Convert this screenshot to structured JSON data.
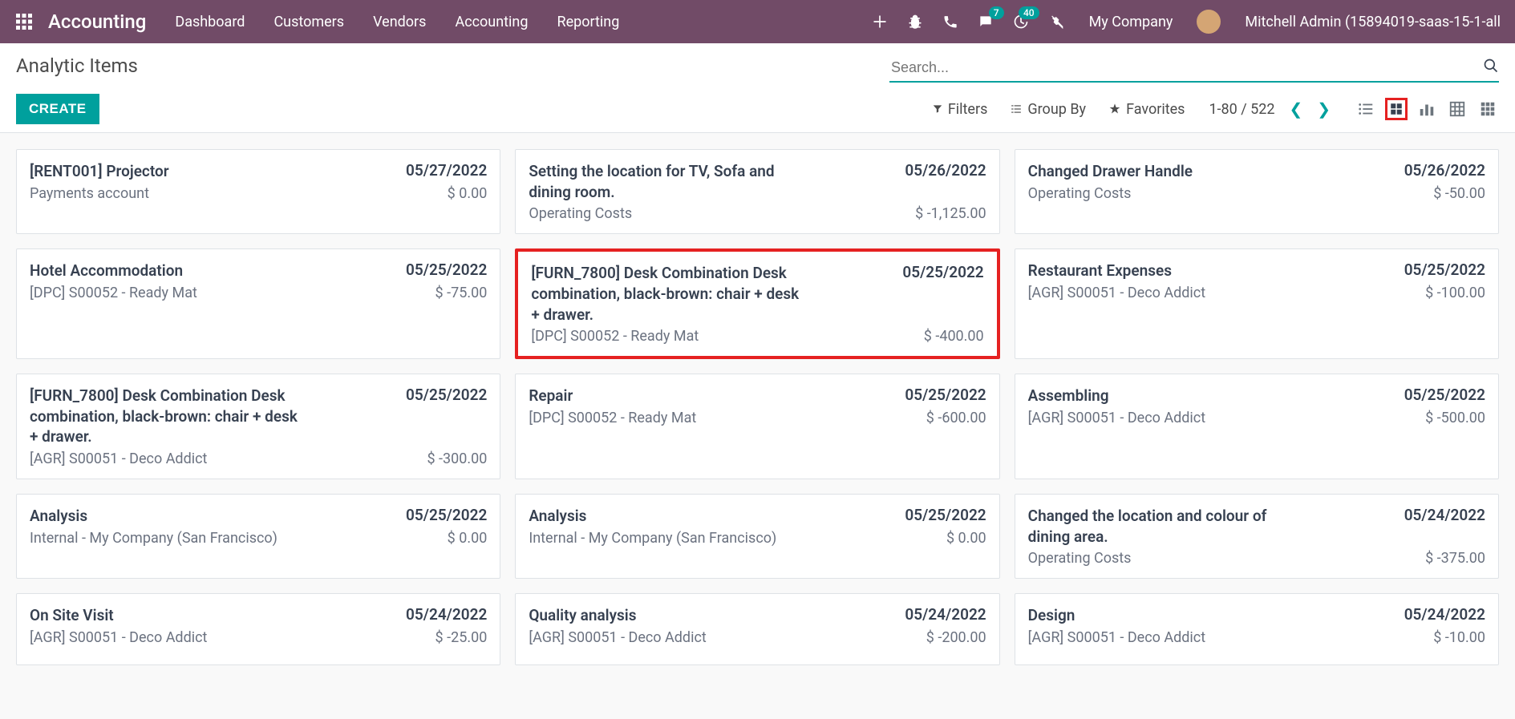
{
  "topnav": {
    "app_title": "Accounting",
    "links": [
      "Dashboard",
      "Customers",
      "Vendors",
      "Accounting",
      "Reporting"
    ],
    "messages_badge": "7",
    "activities_badge": "40",
    "company": "My Company",
    "username": "Mitchell Admin (15894019-saas-15-1-all"
  },
  "page": {
    "title": "Analytic Items",
    "create_label": "CREATE",
    "search_placeholder": "Search...",
    "filters_label": "Filters",
    "groupby_label": "Group By",
    "favorites_label": "Favorites",
    "pager": "1-80 / 522"
  },
  "cards": [
    {
      "title": "[RENT001] Projector",
      "date": "05/27/2022",
      "account": "Payments account",
      "amount": "$ 0.00"
    },
    {
      "title": "Setting the location for TV, Sofa and dining room.",
      "date": "05/26/2022",
      "account": "Operating Costs",
      "amount": "$ -1,125.00"
    },
    {
      "title": "Changed Drawer Handle",
      "date": "05/26/2022",
      "account": "Operating Costs",
      "amount": "$ -50.00"
    },
    {
      "title": "Hotel Accommodation",
      "date": "05/25/2022",
      "account": "[DPC] S00052 - Ready Mat",
      "amount": "$ -75.00"
    },
    {
      "title": "[FURN_7800] Desk Combination Desk combination, black-brown: chair + desk + drawer.",
      "date": "05/25/2022",
      "account": "[DPC] S00052 - Ready Mat",
      "amount": "$ -400.00",
      "highlighted": true
    },
    {
      "title": "Restaurant Expenses",
      "date": "05/25/2022",
      "account": "[AGR] S00051 - Deco Addict",
      "amount": "$ -100.00"
    },
    {
      "title": "[FURN_7800] Desk Combination Desk combination, black-brown: chair + desk + drawer.",
      "date": "05/25/2022",
      "account": "[AGR] S00051 - Deco Addict",
      "amount": "$ -300.00"
    },
    {
      "title": "Repair",
      "date": "05/25/2022",
      "account": "[DPC] S00052 - Ready Mat",
      "amount": "$ -600.00"
    },
    {
      "title": "Assembling",
      "date": "05/25/2022",
      "account": "[AGR] S00051 - Deco Addict",
      "amount": "$ -500.00"
    },
    {
      "title": "Analysis",
      "date": "05/25/2022",
      "account": "Internal - My Company (San Francisco)",
      "amount": "$ 0.00"
    },
    {
      "title": "Analysis",
      "date": "05/25/2022",
      "account": "Internal - My Company (San Francisco)",
      "amount": "$ 0.00"
    },
    {
      "title": "Changed the location and colour of dining area.",
      "date": "05/24/2022",
      "account": "Operating Costs",
      "amount": "$ -375.00"
    },
    {
      "title": "On Site Visit",
      "date": "05/24/2022",
      "account": "[AGR] S00051 - Deco Addict",
      "amount": "$ -25.00"
    },
    {
      "title": "Quality analysis",
      "date": "05/24/2022",
      "account": "[AGR] S00051 - Deco Addict",
      "amount": "$ -200.00"
    },
    {
      "title": "Design",
      "date": "05/24/2022",
      "account": "[AGR] S00051 - Deco Addict",
      "amount": "$ -10.00"
    }
  ]
}
